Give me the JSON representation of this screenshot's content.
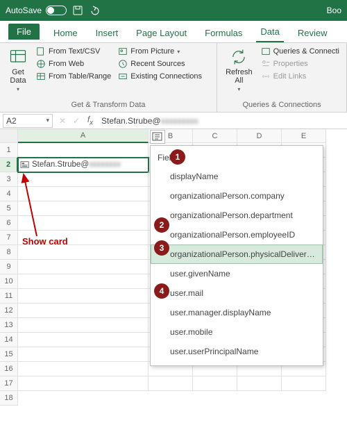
{
  "titlebar": {
    "autosave": "AutoSave",
    "doc_suffix": "Boo"
  },
  "tabs": {
    "file": "File",
    "home": "Home",
    "insert": "Insert",
    "page_layout": "Page Layout",
    "formulas": "Formulas",
    "data": "Data",
    "review": "Review"
  },
  "ribbon": {
    "get_data": "Get\nData",
    "from_text": "From Text/CSV",
    "from_web": "From Web",
    "from_table": "From Table/Range",
    "from_picture": "From Picture",
    "recent": "Recent Sources",
    "existing": "Existing Connections",
    "group1_label": "Get & Transform Data",
    "refresh_all": "Refresh\nAll",
    "queries": "Queries & Connecti",
    "properties": "Properties",
    "edit_links": "Edit Links",
    "group2_label": "Queries & Connections"
  },
  "formula": {
    "cellref": "A2",
    "value_prefix": "Stefan.Strube@",
    "value_blur": "xxxxxxxxx"
  },
  "columns": [
    "A",
    "B",
    "C",
    "D",
    "E"
  ],
  "rows": [
    "1",
    "2",
    "3",
    "4",
    "5",
    "6",
    "7",
    "8",
    "9",
    "10",
    "11",
    "12",
    "13",
    "14",
    "15",
    "16",
    "17",
    "18"
  ],
  "cellA2_prefix": "Stefan.Strube@",
  "cellA2_blur": "xxxxxxxx",
  "dropdown": {
    "header": "Field",
    "items": [
      "displayName",
      "organizationalPerson.company",
      "organizationalPerson.department",
      "organizationalPerson.employeeID",
      "organizationalPerson.physicalDeliveryOfficeNam",
      "user.givenName",
      "user.mail",
      "user.manager.displayName",
      "user.mobile",
      "user.userPrincipalName"
    ],
    "highlight_index": 4
  },
  "annotation": {
    "show_card": "Show card"
  },
  "markers": [
    "1",
    "2",
    "3",
    "4"
  ]
}
